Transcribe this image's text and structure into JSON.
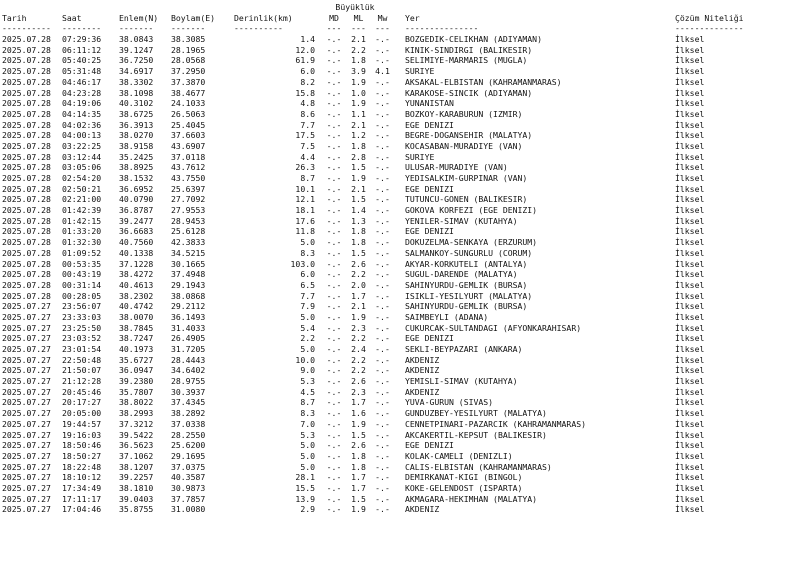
{
  "header": {
    "magnitude_group": "Büyüklük",
    "columns": {
      "date": "Tarih",
      "time": "Saat",
      "lat": "Enlem(N)",
      "lon": "Boylam(E)",
      "depth": "Derinlik(km)",
      "md": "MD",
      "ml": "ML",
      "mw": "Mw",
      "place": "Yer",
      "quality": "Çözüm Niteliği"
    },
    "separators": {
      "date": "----------",
      "time": "--------",
      "lat": "-------",
      "lon": "-------",
      "depth": "----------",
      "md": "---",
      "ml": "---",
      "mw": "---",
      "place": "---------------",
      "quality": "--------------"
    }
  },
  "rows": [
    {
      "date": "2025.07.28",
      "time": "07:29:36",
      "lat": "38.0843",
      "lon": "38.3085",
      "depth": "1.4",
      "md": "-.-",
      "ml": "2.1",
      "mw": "-.-",
      "place": "BOZGEDIK-CELIKHAN (ADIYAMAN)",
      "quality": "İlksel"
    },
    {
      "date": "2025.07.28",
      "time": "06:11:12",
      "lat": "39.1247",
      "lon": "28.1965",
      "depth": "12.0",
      "md": "-.-",
      "ml": "2.2",
      "mw": "-.-",
      "place": "KINIK-SINDIRGI (BALIKESIR)",
      "quality": "İlksel"
    },
    {
      "date": "2025.07.28",
      "time": "05:40:25",
      "lat": "36.7250",
      "lon": "28.0568",
      "depth": "61.9",
      "md": "-.-",
      "ml": "1.8",
      "mw": "-.-",
      "place": "SELIMIYE-MARMARIS (MUGLA)",
      "quality": "İlksel"
    },
    {
      "date": "2025.07.28",
      "time": "05:31:48",
      "lat": "34.6917",
      "lon": "37.2950",
      "depth": "6.0",
      "md": "-.-",
      "ml": "3.9",
      "mw": "4.1",
      "place": "SURIYE",
      "quality": "İlksel"
    },
    {
      "date": "2025.07.28",
      "time": "04:46:17",
      "lat": "38.3302",
      "lon": "37.3870",
      "depth": "8.2",
      "md": "-.-",
      "ml": "1.9",
      "mw": "-.-",
      "place": "AKSAKAL-ELBISTAN (KAHRAMANMARAS)",
      "quality": "İlksel"
    },
    {
      "date": "2025.07.28",
      "time": "04:23:28",
      "lat": "38.1098",
      "lon": "38.4677",
      "depth": "15.8",
      "md": "-.-",
      "ml": "1.0",
      "mw": "-.-",
      "place": "KARAKOSE-SINCIK (ADIYAMAN)",
      "quality": "İlksel"
    },
    {
      "date": "2025.07.28",
      "time": "04:19:06",
      "lat": "40.3102",
      "lon": "24.1033",
      "depth": "4.8",
      "md": "-.-",
      "ml": "1.9",
      "mw": "-.-",
      "place": "YUNANISTAN",
      "quality": "İlksel"
    },
    {
      "date": "2025.07.28",
      "time": "04:14:35",
      "lat": "38.6725",
      "lon": "26.5063",
      "depth": "8.6",
      "md": "-.-",
      "ml": "1.1",
      "mw": "-.-",
      "place": "BOZKOY-KARABURUN (IZMIR)",
      "quality": "İlksel"
    },
    {
      "date": "2025.07.28",
      "time": "04:02:36",
      "lat": "36.3913",
      "lon": "25.4045",
      "depth": "7.7",
      "md": "-.-",
      "ml": "2.1",
      "mw": "-.-",
      "place": "EGE DENIZI",
      "quality": "İlksel"
    },
    {
      "date": "2025.07.28",
      "time": "04:00:13",
      "lat": "38.0270",
      "lon": "37.6603",
      "depth": "17.5",
      "md": "-.-",
      "ml": "1.2",
      "mw": "-.-",
      "place": "BEGRE-DOGANSEHIR (MALATYA)",
      "quality": "İlksel"
    },
    {
      "date": "2025.07.28",
      "time": "03:22:25",
      "lat": "38.9158",
      "lon": "43.6907",
      "depth": "7.5",
      "md": "-.-",
      "ml": "1.8",
      "mw": "-.-",
      "place": "KOCASABAN-MURADIYE (VAN)",
      "quality": "İlksel"
    },
    {
      "date": "2025.07.28",
      "time": "03:12:44",
      "lat": "35.2425",
      "lon": "37.0118",
      "depth": "4.4",
      "md": "-.-",
      "ml": "2.8",
      "mw": "-.-",
      "place": "SURIYE",
      "quality": "İlksel"
    },
    {
      "date": "2025.07.28",
      "time": "03:05:06",
      "lat": "38.8925",
      "lon": "43.7612",
      "depth": "26.3",
      "md": "-.-",
      "ml": "1.5",
      "mw": "-.-",
      "place": "ULUSAR-MURADIYE (VAN)",
      "quality": "İlksel"
    },
    {
      "date": "2025.07.28",
      "time": "02:54:20",
      "lat": "38.1532",
      "lon": "43.7550",
      "depth": "8.7",
      "md": "-.-",
      "ml": "1.9",
      "mw": "-.-",
      "place": "YEDISALKIM-GURPINAR (VAN)",
      "quality": "İlksel"
    },
    {
      "date": "2025.07.28",
      "time": "02:50:21",
      "lat": "36.6952",
      "lon": "25.6397",
      "depth": "10.1",
      "md": "-.-",
      "ml": "2.1",
      "mw": "-.-",
      "place": "EGE DENIZI",
      "quality": "İlksel"
    },
    {
      "date": "2025.07.28",
      "time": "02:21:00",
      "lat": "40.0790",
      "lon": "27.7092",
      "depth": "12.1",
      "md": "-.-",
      "ml": "1.5",
      "mw": "-.-",
      "place": "TUTUNCU-GONEN (BALIKESIR)",
      "quality": "İlksel"
    },
    {
      "date": "2025.07.28",
      "time": "01:42:39",
      "lat": "36.8787",
      "lon": "27.9553",
      "depth": "18.1",
      "md": "-.-",
      "ml": "1.4",
      "mw": "-.-",
      "place": "GOKOVA KORFEZI (EGE DENIZI)",
      "quality": "İlksel"
    },
    {
      "date": "2025.07.28",
      "time": "01:42:15",
      "lat": "39.2477",
      "lon": "28.9453",
      "depth": "17.6",
      "md": "-.-",
      "ml": "1.3",
      "mw": "-.-",
      "place": "YENILER-SIMAV (KUTAHYA)",
      "quality": "İlksel"
    },
    {
      "date": "2025.07.28",
      "time": "01:33:20",
      "lat": "36.6683",
      "lon": "25.6128",
      "depth": "11.8",
      "md": "-.-",
      "ml": "1.8",
      "mw": "-.-",
      "place": "EGE DENIZI",
      "quality": "İlksel"
    },
    {
      "date": "2025.07.28",
      "time": "01:32:30",
      "lat": "40.7560",
      "lon": "42.3833",
      "depth": "5.0",
      "md": "-.-",
      "ml": "1.8",
      "mw": "-.-",
      "place": "DOKUZELMA-SENKAYA (ERZURUM)",
      "quality": "İlksel"
    },
    {
      "date": "2025.07.28",
      "time": "01:09:52",
      "lat": "40.1338",
      "lon": "34.5215",
      "depth": "8.3",
      "md": "-.-",
      "ml": "1.5",
      "mw": "-.-",
      "place": "SALMANKOY-SUNGURLU (CORUM)",
      "quality": "İlksel"
    },
    {
      "date": "2025.07.28",
      "time": "00:53:35",
      "lat": "37.1228",
      "lon": "30.1665",
      "depth": "103.0",
      "md": "-.-",
      "ml": "2.6",
      "mw": "-.-",
      "place": "AKYAR-KORKUTELI (ANTALYA)",
      "quality": "İlksel"
    },
    {
      "date": "2025.07.28",
      "time": "00:43:19",
      "lat": "38.4272",
      "lon": "37.4948",
      "depth": "6.0",
      "md": "-.-",
      "ml": "2.2",
      "mw": "-.-",
      "place": "SUGUL-DARENDE (MALATYA)",
      "quality": "İlksel"
    },
    {
      "date": "2025.07.28",
      "time": "00:31:14",
      "lat": "40.4613",
      "lon": "29.1943",
      "depth": "6.5",
      "md": "-.-",
      "ml": "2.0",
      "mw": "-.-",
      "place": "SAHINYURDU-GEMLIK (BURSA)",
      "quality": "İlksel"
    },
    {
      "date": "2025.07.28",
      "time": "00:28:05",
      "lat": "38.2302",
      "lon": "38.0868",
      "depth": "7.7",
      "md": "-.-",
      "ml": "1.7",
      "mw": "-.-",
      "place": "ISIKLI-YESILYURT (MALATYA)",
      "quality": "İlksel"
    },
    {
      "date": "2025.07.27",
      "time": "23:56:07",
      "lat": "40.4742",
      "lon": "29.2112",
      "depth": "7.9",
      "md": "-.-",
      "ml": "2.1",
      "mw": "-.-",
      "place": "SAHINYURDU-GEMLIK (BURSA)",
      "quality": "İlksel"
    },
    {
      "date": "2025.07.27",
      "time": "23:33:03",
      "lat": "38.0070",
      "lon": "36.1493",
      "depth": "5.0",
      "md": "-.-",
      "ml": "1.9",
      "mw": "-.-",
      "place": "SAIMBEYLI (ADANA)",
      "quality": "İlksel"
    },
    {
      "date": "2025.07.27",
      "time": "23:25:50",
      "lat": "38.7845",
      "lon": "31.4033",
      "depth": "5.4",
      "md": "-.-",
      "ml": "2.3",
      "mw": "-.-",
      "place": "CUKURCAK-SULTANDAGI (AFYONKARAHISAR)",
      "quality": "İlksel"
    },
    {
      "date": "2025.07.27",
      "time": "23:03:52",
      "lat": "38.7247",
      "lon": "26.4905",
      "depth": "2.2",
      "md": "-.-",
      "ml": "2.2",
      "mw": "-.-",
      "place": "EGE DENIZI",
      "quality": "İlksel"
    },
    {
      "date": "2025.07.27",
      "time": "23:01:54",
      "lat": "40.1973",
      "lon": "31.7205",
      "depth": "5.0",
      "md": "-.-",
      "ml": "2.4",
      "mw": "-.-",
      "place": "SEKLI-BEYPAZARI (ANKARA)",
      "quality": "İlksel"
    },
    {
      "date": "2025.07.27",
      "time": "22:50:48",
      "lat": "35.6727",
      "lon": "28.4443",
      "depth": "10.0",
      "md": "-.-",
      "ml": "2.2",
      "mw": "-.-",
      "place": "AKDENIZ",
      "quality": "İlksel"
    },
    {
      "date": "2025.07.27",
      "time": "21:50:07",
      "lat": "36.0947",
      "lon": "34.6402",
      "depth": "9.0",
      "md": "-.-",
      "ml": "2.2",
      "mw": "-.-",
      "place": "AKDENIZ",
      "quality": "İlksel"
    },
    {
      "date": "2025.07.27",
      "time": "21:12:28",
      "lat": "39.2380",
      "lon": "28.9755",
      "depth": "5.3",
      "md": "-.-",
      "ml": "2.6",
      "mw": "-.-",
      "place": "YEMISLI-SIMAV (KUTAHYA)",
      "quality": "İlksel"
    },
    {
      "date": "2025.07.27",
      "time": "20:45:46",
      "lat": "35.7807",
      "lon": "30.3937",
      "depth": "4.5",
      "md": "-.-",
      "ml": "2.3",
      "mw": "-.-",
      "place": "AKDENIZ",
      "quality": "İlksel"
    },
    {
      "date": "2025.07.27",
      "time": "20:17:27",
      "lat": "38.8022",
      "lon": "37.4345",
      "depth": "8.7",
      "md": "-.-",
      "ml": "1.7",
      "mw": "-.-",
      "place": "YUVA-GURUN (SIVAS)",
      "quality": "İlksel"
    },
    {
      "date": "2025.07.27",
      "time": "20:05:00",
      "lat": "38.2993",
      "lon": "38.2892",
      "depth": "8.3",
      "md": "-.-",
      "ml": "1.6",
      "mw": "-.-",
      "place": "GUNDUZBEY-YESILYURT (MALATYA)",
      "quality": "İlksel"
    },
    {
      "date": "2025.07.27",
      "time": "19:44:57",
      "lat": "37.3212",
      "lon": "37.0338",
      "depth": "7.0",
      "md": "-.-",
      "ml": "1.9",
      "mw": "-.-",
      "place": "CENNETPINARI-PAZARCIK (KAHRAMANMARAS)",
      "quality": "İlksel"
    },
    {
      "date": "2025.07.27",
      "time": "19:16:03",
      "lat": "39.5422",
      "lon": "28.2550",
      "depth": "5.3",
      "md": "-.-",
      "ml": "1.5",
      "mw": "-.-",
      "place": "AKCAKERTIL-KEPSUT (BALIKESIR)",
      "quality": "İlksel"
    },
    {
      "date": "2025.07.27",
      "time": "18:50:46",
      "lat": "36.5623",
      "lon": "25.6200",
      "depth": "5.0",
      "md": "-.-",
      "ml": "2.6",
      "mw": "-.-",
      "place": "EGE DENIZI",
      "quality": "İlksel"
    },
    {
      "date": "2025.07.27",
      "time": "18:50:27",
      "lat": "37.1062",
      "lon": "29.1695",
      "depth": "5.0",
      "md": "-.-",
      "ml": "1.8",
      "mw": "-.-",
      "place": "KOLAK-CAMELI (DENIZLI)",
      "quality": "İlksel"
    },
    {
      "date": "2025.07.27",
      "time": "18:22:48",
      "lat": "38.1207",
      "lon": "37.0375",
      "depth": "5.0",
      "md": "-.-",
      "ml": "1.8",
      "mw": "-.-",
      "place": "CALIS-ELBISTAN (KAHRAMANMARAS)",
      "quality": "İlksel"
    },
    {
      "date": "2025.07.27",
      "time": "18:10:12",
      "lat": "39.2257",
      "lon": "40.3587",
      "depth": "28.1",
      "md": "-.-",
      "ml": "1.7",
      "mw": "-.-",
      "place": "DEMIRKANAT-KIGI (BINGOL)",
      "quality": "İlksel"
    },
    {
      "date": "2025.07.27",
      "time": "17:34:49",
      "lat": "38.1810",
      "lon": "30.9873",
      "depth": "15.5",
      "md": "-.-",
      "ml": "1.7",
      "mw": "-.-",
      "place": "KOKE-GELENDOST (ISPARTA)",
      "quality": "İlksel"
    },
    {
      "date": "2025.07.27",
      "time": "17:11:17",
      "lat": "39.0403",
      "lon": "37.7857",
      "depth": "13.9",
      "md": "-.-",
      "ml": "1.5",
      "mw": "-.-",
      "place": "AKMAGARA-HEKIMHAN (MALATYA)",
      "quality": "İlksel"
    },
    {
      "date": "2025.07.27",
      "time": "17:04:46",
      "lat": "35.8755",
      "lon": "31.0080",
      "depth": "2.9",
      "md": "-.-",
      "ml": "1.9",
      "mw": "-.-",
      "place": "AKDENIZ",
      "quality": "İlksel"
    }
  ]
}
